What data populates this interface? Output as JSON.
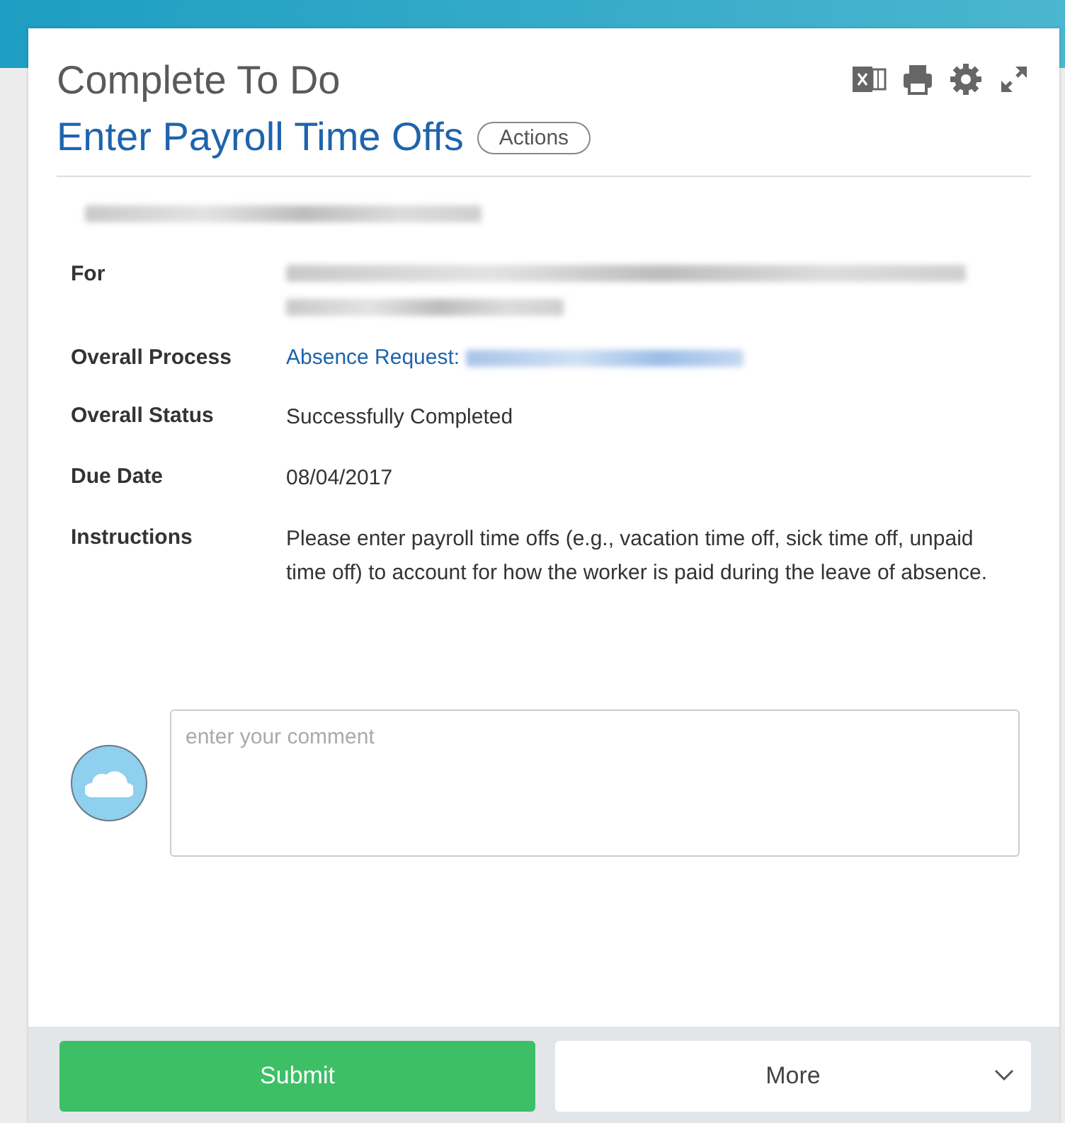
{
  "header": {
    "title": "Complete To Do",
    "subtitle": "Enter Payroll Time Offs",
    "actions_button": "Actions"
  },
  "fields": [
    {
      "label": "For",
      "kind": "redacted"
    },
    {
      "label": "Overall Process",
      "kind": "link",
      "value": "Absence Request:"
    },
    {
      "label": "Overall Status",
      "kind": "text",
      "value": "Successfully Completed"
    },
    {
      "label": "Due Date",
      "kind": "text",
      "value": "08/04/2017"
    },
    {
      "label": "Instructions",
      "kind": "text",
      "value": "Please enter payroll time offs (e.g., vacation time off, sick time off, unpaid time off) to account for how the worker is paid during the leave of absence."
    }
  ],
  "comment": {
    "placeholder": "enter your comment"
  },
  "footer": {
    "submit": "Submit",
    "more": "More"
  }
}
